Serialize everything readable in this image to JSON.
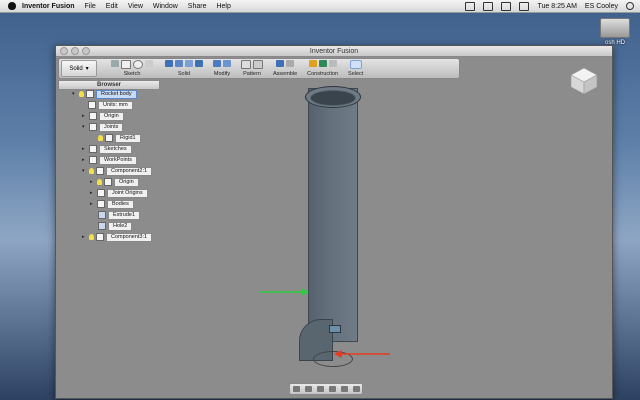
{
  "menubar": {
    "app": "Inventor Fusion",
    "items": [
      "File",
      "Edit",
      "View",
      "Window",
      "Share",
      "Help"
    ],
    "clock": "Tue 8:25 AM",
    "user": "ES Cooley"
  },
  "desktop": {
    "drive_label": "osh HD"
  },
  "window": {
    "title": "Inventor Fusion"
  },
  "ribbon": {
    "mode": "Solid",
    "groups": [
      "Sketch",
      "Solid",
      "Modify",
      "Pattern",
      "Assemble",
      "Construction",
      "Select"
    ]
  },
  "browser": {
    "title": "Browser",
    "nodes": [
      {
        "label": "Rocket body"
      },
      {
        "label": "Units: mm"
      },
      {
        "label": "Origin"
      },
      {
        "label": "Joints"
      },
      {
        "label": "Rigid1"
      },
      {
        "label": "Sketches"
      },
      {
        "label": "WorkPoints"
      },
      {
        "label": "Component2:1"
      },
      {
        "label": "Origin"
      },
      {
        "label": "Joint Origins"
      },
      {
        "label": "Bodies"
      },
      {
        "label": "Extrude1"
      },
      {
        "label": "Hole2"
      },
      {
        "label": "Component3:1"
      }
    ]
  },
  "colors": {
    "green_arrow": "#2ecc40",
    "red_arrow": "#e8391f"
  }
}
